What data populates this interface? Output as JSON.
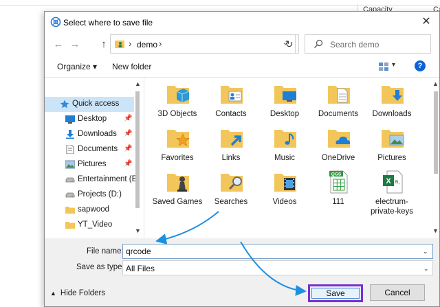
{
  "background": {
    "column_header": "Capacity",
    "column_header_2": "Ca"
  },
  "dialog": {
    "title": "Select where to save file",
    "title_icon": "electrum-icon",
    "close_symbol": "✕"
  },
  "address_bar": {
    "back_symbol": "←",
    "forward_symbol": "→",
    "up_symbol": "↑",
    "separator": "›",
    "path": "demo",
    "refresh_symbol": "↻",
    "search_placeholder": "Search demo"
  },
  "toolbar": {
    "organize_label": "Organize ▾",
    "new_folder_label": "New folder",
    "view_drop_symbol": "▾",
    "help_symbol": "?"
  },
  "navigation": {
    "items": [
      {
        "label": "Quick access",
        "icon": "star-icon",
        "pinned": false,
        "selected": true
      },
      {
        "label": "Desktop",
        "icon": "desktop-icon",
        "pinned": true
      },
      {
        "label": "Downloads",
        "icon": "download-icon",
        "pinned": true
      },
      {
        "label": "Documents",
        "icon": "document-icon",
        "pinned": true
      },
      {
        "label": "Pictures",
        "icon": "pictures-icon",
        "pinned": true
      },
      {
        "label": "Entertainment (E:",
        "icon": "drive-icon",
        "pinned": false
      },
      {
        "label": "Projects (D:)",
        "icon": "drive-icon",
        "pinned": false
      },
      {
        "label": "sapwood",
        "icon": "folder-icon",
        "pinned": false
      },
      {
        "label": "YT_Video",
        "icon": "folder-icon",
        "pinned": false
      }
    ],
    "pin_symbol": "📌"
  },
  "files": {
    "items": [
      {
        "label": "3D Objects",
        "icon": "3d-objects-folder-icon"
      },
      {
        "label": "Contacts",
        "icon": "contacts-folder-icon"
      },
      {
        "label": "Desktop",
        "icon": "desktop-folder-icon"
      },
      {
        "label": "Documents",
        "icon": "documents-folder-icon"
      },
      {
        "label": "Downloads",
        "icon": "downloads-folder-icon"
      },
      {
        "label": "Favorites",
        "icon": "favorites-folder-icon"
      },
      {
        "label": "Links",
        "icon": "links-folder-icon"
      },
      {
        "label": "Music",
        "icon": "music-folder-icon"
      },
      {
        "label": "OneDrive",
        "icon": "onedrive-folder-icon"
      },
      {
        "label": "Pictures",
        "icon": "pictures-folder-icon"
      },
      {
        "label": "Saved Games",
        "icon": "saved-games-folder-icon"
      },
      {
        "label": "Searches",
        "icon": "searches-folder-icon"
      },
      {
        "label": "Videos",
        "icon": "videos-folder-icon"
      },
      {
        "label": "111",
        "icon": "qgs-file-icon",
        "badge": "QGS"
      },
      {
        "label": "electrum-private-keys",
        "icon": "excel-file-icon",
        "badge": "X"
      }
    ]
  },
  "form": {
    "filename_label": "File name:",
    "filename_value": "qrcode",
    "save_as_type_label": "Save as type:",
    "save_as_type_value": "All Files",
    "drop_symbol": "⌄",
    "hide_folders_label": "Hide Folders",
    "save_label": "Save",
    "cancel_label": "Cancel"
  },
  "colors": {
    "accent": "#0d63d6",
    "folder": "#f2c65a",
    "highlight_box": "#7b2fd3",
    "annotation_arrow": "#1b8fe0",
    "selected_nav": "#cce4f7"
  }
}
